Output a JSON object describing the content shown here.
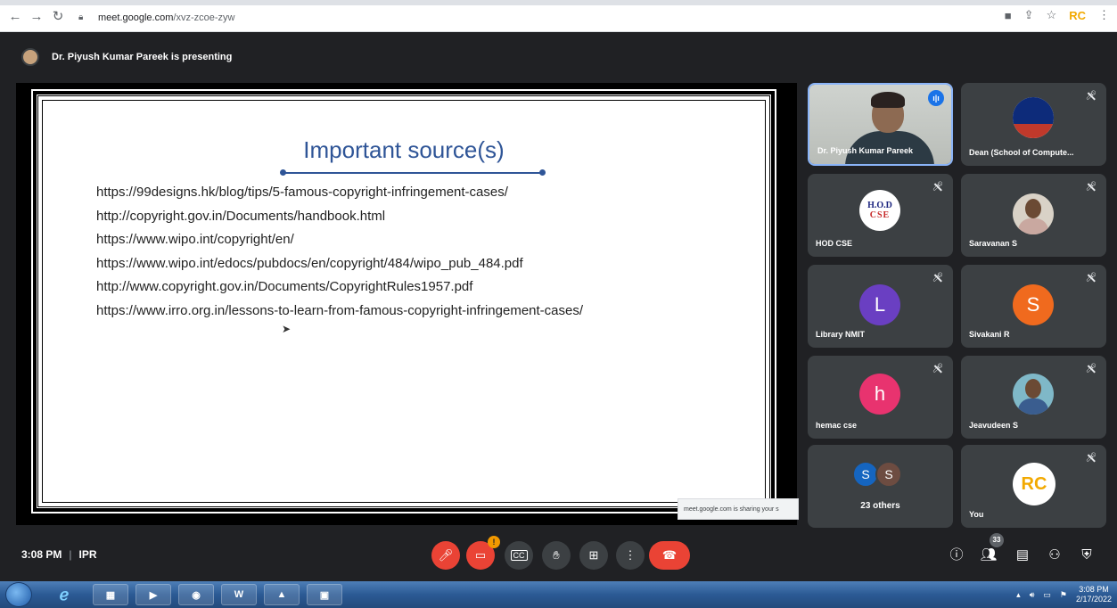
{
  "browser": {
    "back_icon": "arrow-left-icon",
    "forward_icon": "arrow-right-icon",
    "reload_icon": "reload-icon",
    "url_host": "meet.google.com",
    "url_path": "/xvz-zcoe-zyw",
    "extension_label": "RC"
  },
  "meet": {
    "presenting_banner": "Dr. Piyush Kumar Pareek is presenting",
    "time": "3:08 PM",
    "separator": "|",
    "meeting_name": "IPR",
    "share_notice": "meet.google.com is sharing your s",
    "people_count": "33",
    "camera_warning": "!"
  },
  "slide": {
    "title": "Important source(s)",
    "sources": [
      "https://99designs.hk/blog/tips/5-famous-copyright-infringement-cases/",
      "http://copyright.gov.in/Documents/handbook.html",
      "https://www.wipo.int/copyright/en/",
      "https://www.wipo.int/edocs/pubdocs/en/copyright/484/wipo_pub_484.pdf",
      "http://www.copyright.gov.in/Documents/CopyrightRules1957.pdf",
      "https://www.irro.org.in/lessons-to-learn-from-famous-copyright-infringement-cases/"
    ]
  },
  "tiles": {
    "t1": {
      "name": "Dr. Piyush Kumar Pareek"
    },
    "t2": {
      "name": "Dean (School of Compute..."
    },
    "t3": {
      "name": "HOD CSE",
      "logo_line1": "H.O.D",
      "logo_line2": "CSE"
    },
    "t4": {
      "name": "Saravanan S"
    },
    "t5": {
      "name": "Library NMIT",
      "initial": "L",
      "color": "#6a3fc2"
    },
    "t6": {
      "name": "Sivakani R",
      "initial": "S",
      "color": "#f06a1e"
    },
    "t7": {
      "name": "hemac cse",
      "initial": "h",
      "color": "#e8336f"
    },
    "t8": {
      "name": "Jeavudeen S"
    },
    "t9": {
      "label": "23 others",
      "a1": "S",
      "a1_color": "#1565c0",
      "a2": "S",
      "a2_color": "#6d4c41"
    },
    "t10": {
      "name": "You",
      "logo": "RC"
    }
  },
  "taskbar": {
    "clock_time": "3:08 PM",
    "clock_date": "2/17/2022"
  },
  "colors": {
    "meet_bg": "#202124",
    "tile_bg": "#3c4043",
    "end_call": "#ea4335",
    "slide_title": "#2f5597"
  }
}
